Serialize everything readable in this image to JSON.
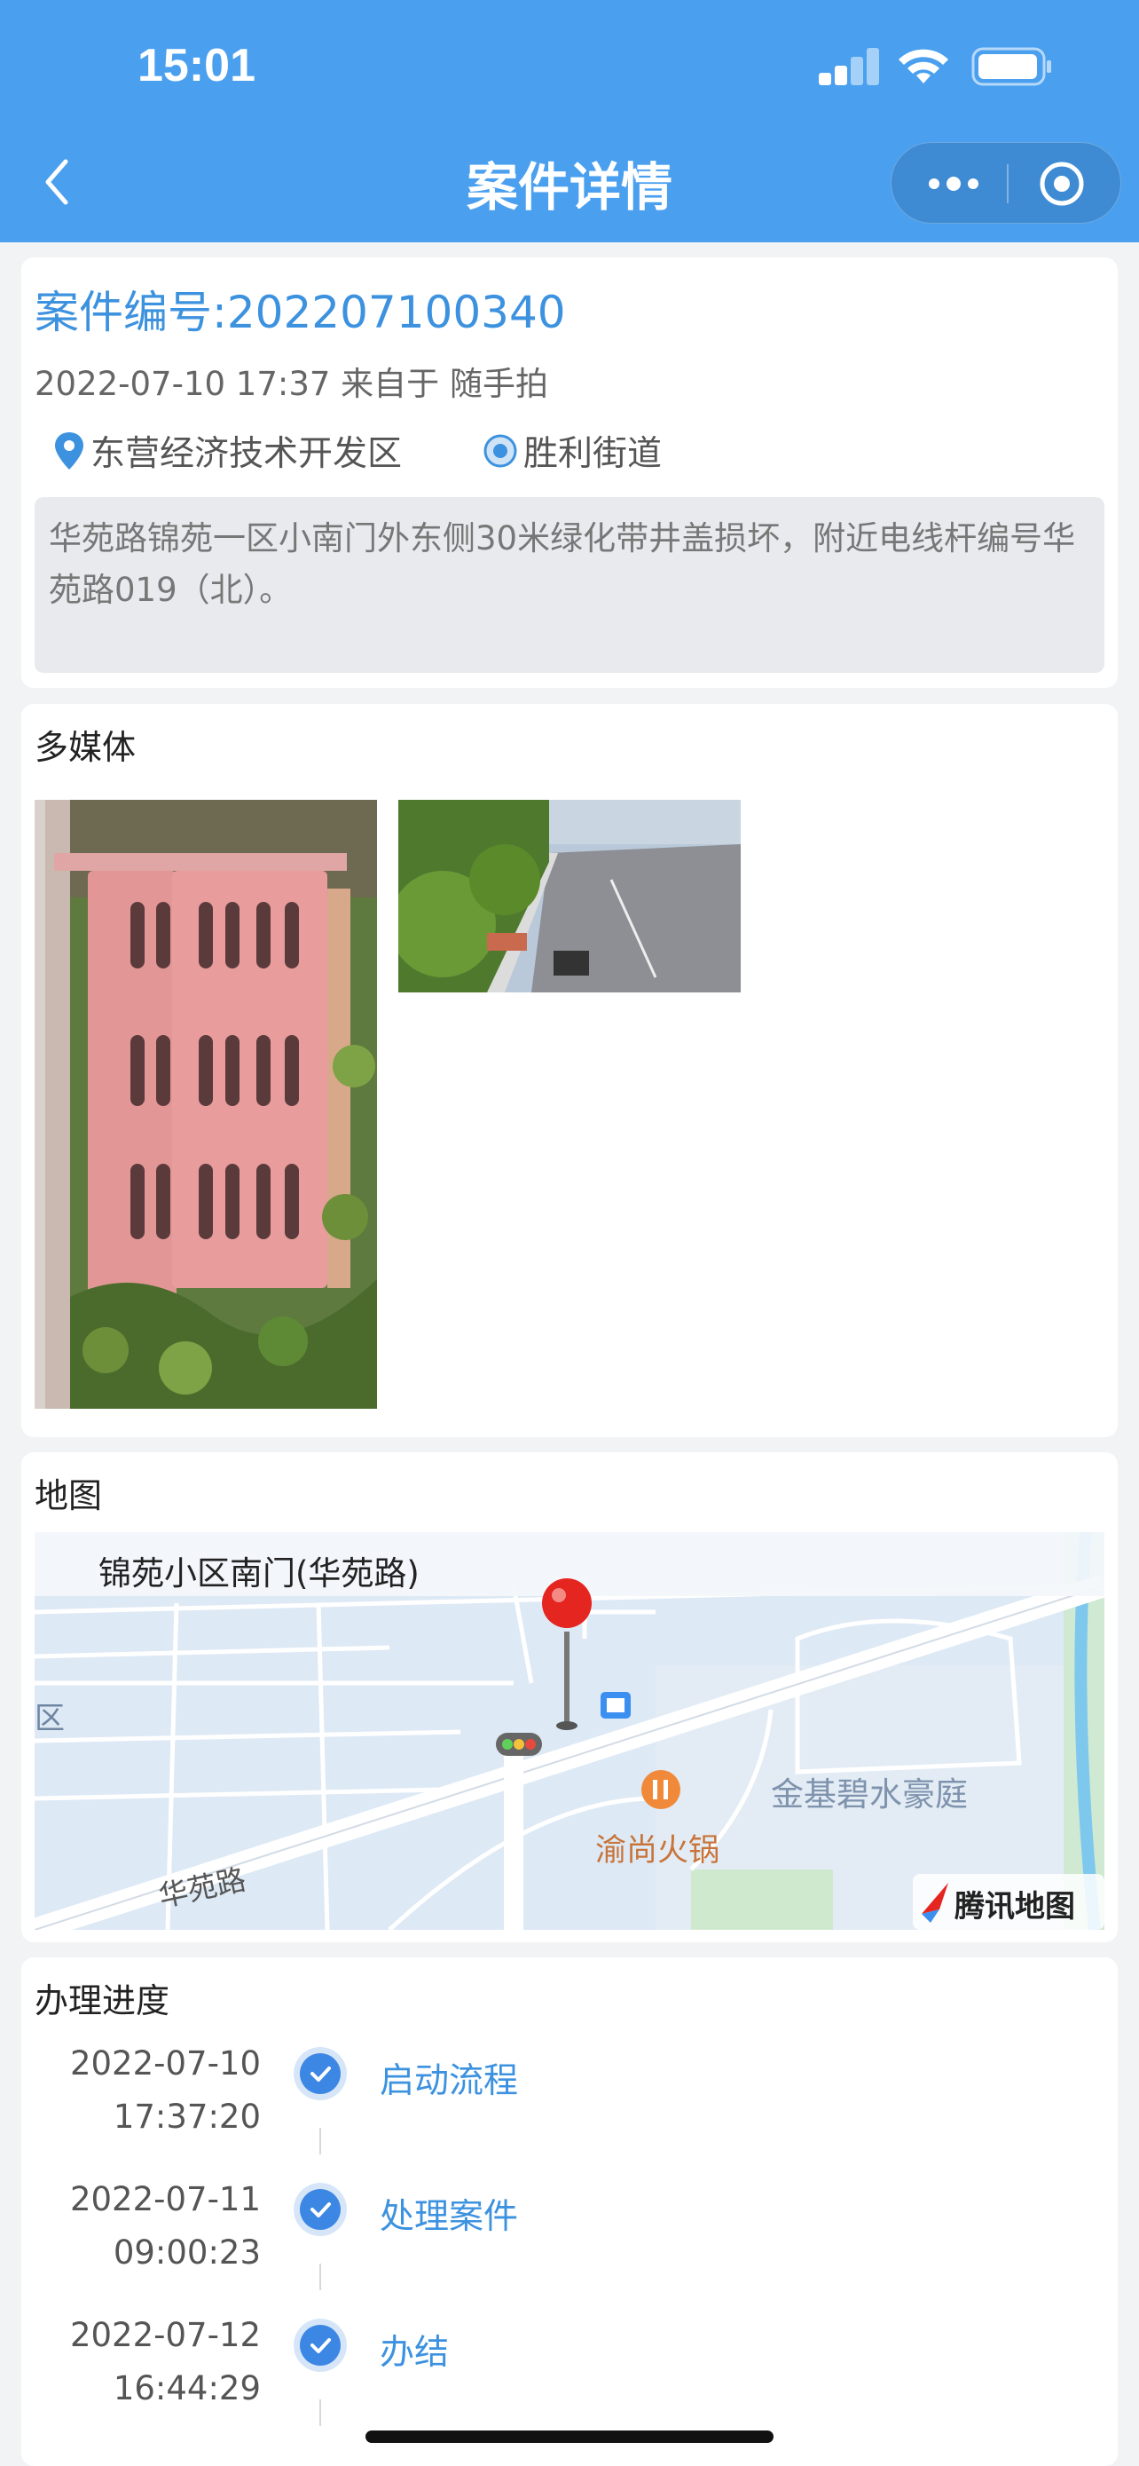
{
  "status_bar": {
    "time": "15:01"
  },
  "nav": {
    "title": "案件详情",
    "back_icon": "chevron-left-icon",
    "more_icon": "more-dots-icon",
    "close_icon": "target-circle-icon"
  },
  "case": {
    "number_label": "案件编号:202207100340",
    "meta": "2022-07-10 17:37 来自于 随手拍",
    "district": "东营经济技术开发区",
    "street": "胜利街道",
    "description": "华苑路锦苑一区小南门外东侧30米绿化带井盖损坏，附近电线杆编号华苑路019（北）。"
  },
  "media": {
    "title": "多媒体"
  },
  "map": {
    "title": "地图",
    "location_name": "锦苑小区南门(华苑路)",
    "labels": {
      "road": "华苑路",
      "community": "金基碧水豪庭",
      "restaurant": "渝尚火锅",
      "edge_text": "区"
    },
    "provider": "腾讯地图"
  },
  "progress": {
    "title": "办理进度",
    "steps": [
      {
        "date": "2022-07-10",
        "time": "17:37:20",
        "label": "启动流程"
      },
      {
        "date": "2022-07-11",
        "time": "09:00:23",
        "label": "处理案件"
      },
      {
        "date": "2022-07-12",
        "time": "16:44:29",
        "label": "办结"
      }
    ]
  },
  "colors": {
    "header": "#4aa0ef",
    "accent": "#3d92df",
    "background": "#f2f3f5"
  }
}
